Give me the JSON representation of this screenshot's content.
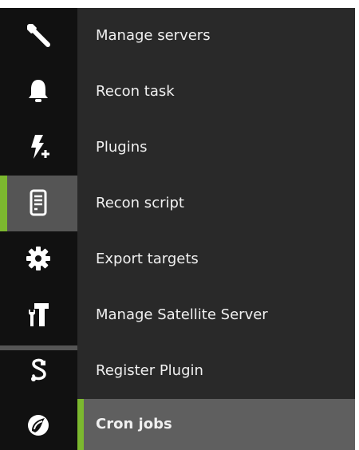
{
  "colors": {
    "background": "#292929",
    "icon_column": "#111111",
    "highlight": "#555555",
    "active_row": "#5f5f5f",
    "accent": "#7cb82f",
    "text": "#f0f0f0"
  },
  "menu": {
    "items": [
      {
        "label": "Manage servers",
        "icon": "wrench-icon",
        "active": false
      },
      {
        "label": "Recon task",
        "icon": "bell-icon",
        "active": false
      },
      {
        "label": "Plugins",
        "icon": "lightning-plus-icon",
        "active": false
      },
      {
        "label": "Recon script",
        "icon": "script-document-icon",
        "active": false,
        "icon_highlighted": true
      },
      {
        "label": "Export targets",
        "icon": "gear-icon",
        "active": false
      },
      {
        "label": "Manage Satellite Server",
        "icon": "tools-hammer-screwdriver-icon",
        "active": false
      },
      {
        "label": "Register Plugin",
        "icon": "plug-cable-icon",
        "active": false
      },
      {
        "label": "Cron jobs",
        "icon": "cron-logo-icon",
        "active": true
      }
    ]
  }
}
